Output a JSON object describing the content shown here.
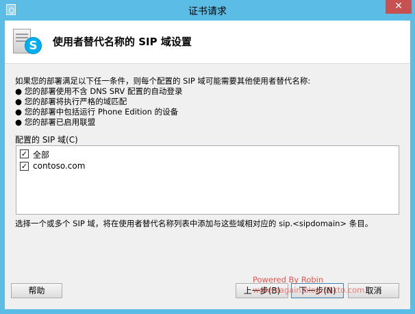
{
  "window": {
    "title": "证书请求",
    "close_glyph": "✕"
  },
  "header": {
    "title": "使用者替代名称的 SIP 域设置",
    "badge": "S"
  },
  "description": {
    "intro": "如果您的部署满足以下任一条件，则每个配置的 SIP 域可能需要其他使用者替代名称:",
    "bullets": [
      "● 您的部署使用不含 DNS SRV 配置的自动登录",
      "● 您的部署将执行严格的域匹配",
      "● 您的部署中包括运行 Phone Edition 的设备",
      "● 您的部署已启用联盟"
    ]
  },
  "sip": {
    "label": "配置的 SIP 域(C)",
    "items": [
      {
        "label": "全部",
        "checked": true,
        "mark": "✓"
      },
      {
        "label": "contoso.com",
        "checked": true,
        "mark": "✓"
      }
    ]
  },
  "hint": "选择一个或多个 SIP 域，将在使用者替代名称列表中添加与这些域相对应的 sip.<sipdomain> 条目。",
  "buttons": {
    "help": "帮助",
    "prev": "上一步(B)",
    "next": "下一步(N)",
    "cancel": "取消"
  },
  "watermark": {
    "line1": "Powered By Robin",
    "line2": "waterzagain.blog.51cto.com"
  },
  "colors": {
    "titlebar": "#5bbde6",
    "close": "#c75050",
    "skype": "#00aff0",
    "watermark": "#e8433a"
  },
  "icons": {
    "app": "certificate-app-icon",
    "header": "skype-server-icon"
  }
}
